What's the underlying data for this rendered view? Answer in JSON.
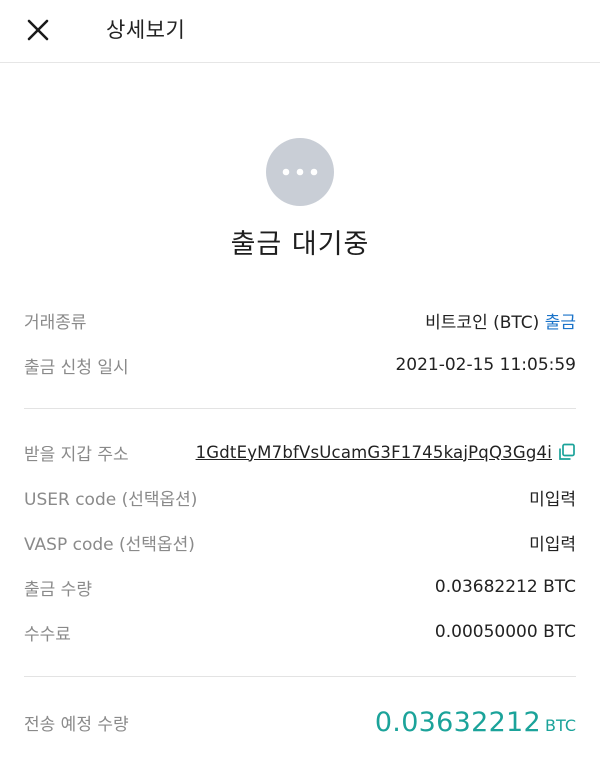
{
  "header": {
    "title": "상세보기"
  },
  "icons": {
    "close": "close-icon",
    "status": "more-dots-icon",
    "copy": "copy-icon"
  },
  "colors": {
    "accent_blue": "#1a73c9",
    "accent_teal": "#1ba39a",
    "status_circle": "#c9ced6"
  },
  "status": {
    "title": "출금 대기중"
  },
  "details": {
    "type_label": "거래종류",
    "type_value": "비트코인 (BTC)",
    "type_direction": "출금",
    "request_time_label": "출금 신청 일시",
    "request_time_value": "2021-02-15 11:05:59",
    "address_label": "받을 지갑 주소",
    "address_value": "1GdtEyM7bfVsUcamG3F1745kajPqQ3Gg4i",
    "user_code_label": "USER code (선택옵션)",
    "user_code_value": "미입력",
    "vasp_code_label": "VASP code (선택옵션)",
    "vasp_code_value": "미입력",
    "amount_label": "출금 수량",
    "amount_value": "0.03682212 BTC",
    "fee_label": "수수료",
    "fee_value": "0.00050000 BTC"
  },
  "total": {
    "label": "전송 예정 수량",
    "amount": "0.03632212",
    "unit": "BTC"
  }
}
